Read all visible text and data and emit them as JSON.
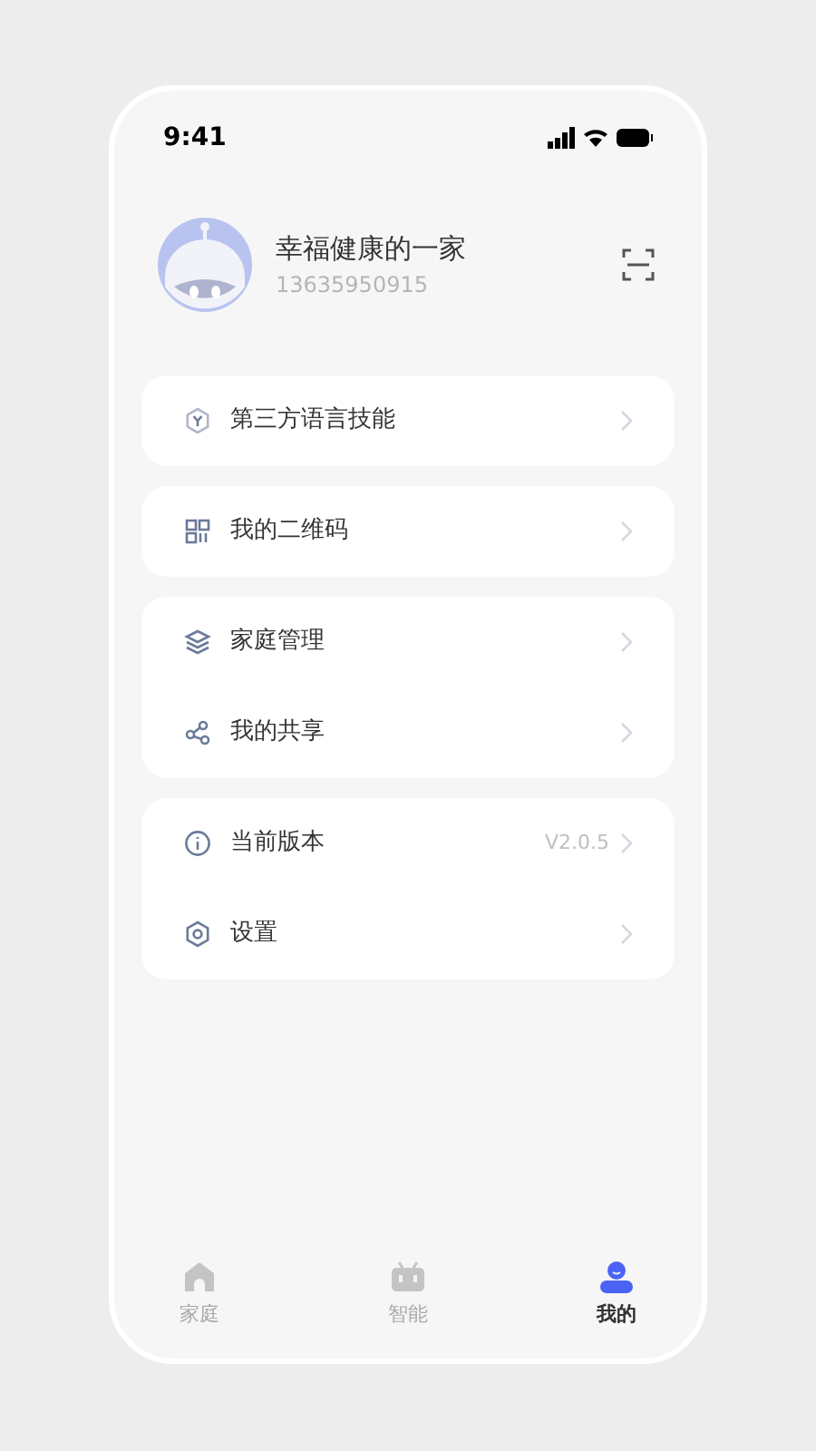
{
  "status_bar": {
    "time": "9:41"
  },
  "profile": {
    "name": "幸福健康的一家",
    "phone": "13635950915"
  },
  "menu_groups": [
    {
      "items": [
        {
          "label": "第三方语言技能"
        }
      ]
    },
    {
      "items": [
        {
          "label": "我的二维码"
        }
      ]
    },
    {
      "items": [
        {
          "label": "家庭管理"
        },
        {
          "label": "我的共享"
        }
      ]
    },
    {
      "items": [
        {
          "label": "当前版本",
          "value": "V2.0.5"
        },
        {
          "label": "设置"
        }
      ]
    }
  ],
  "tab_bar": [
    {
      "label": "家庭",
      "selected": false
    },
    {
      "label": "智能",
      "selected": false
    },
    {
      "label": "我的",
      "selected": true
    }
  ]
}
